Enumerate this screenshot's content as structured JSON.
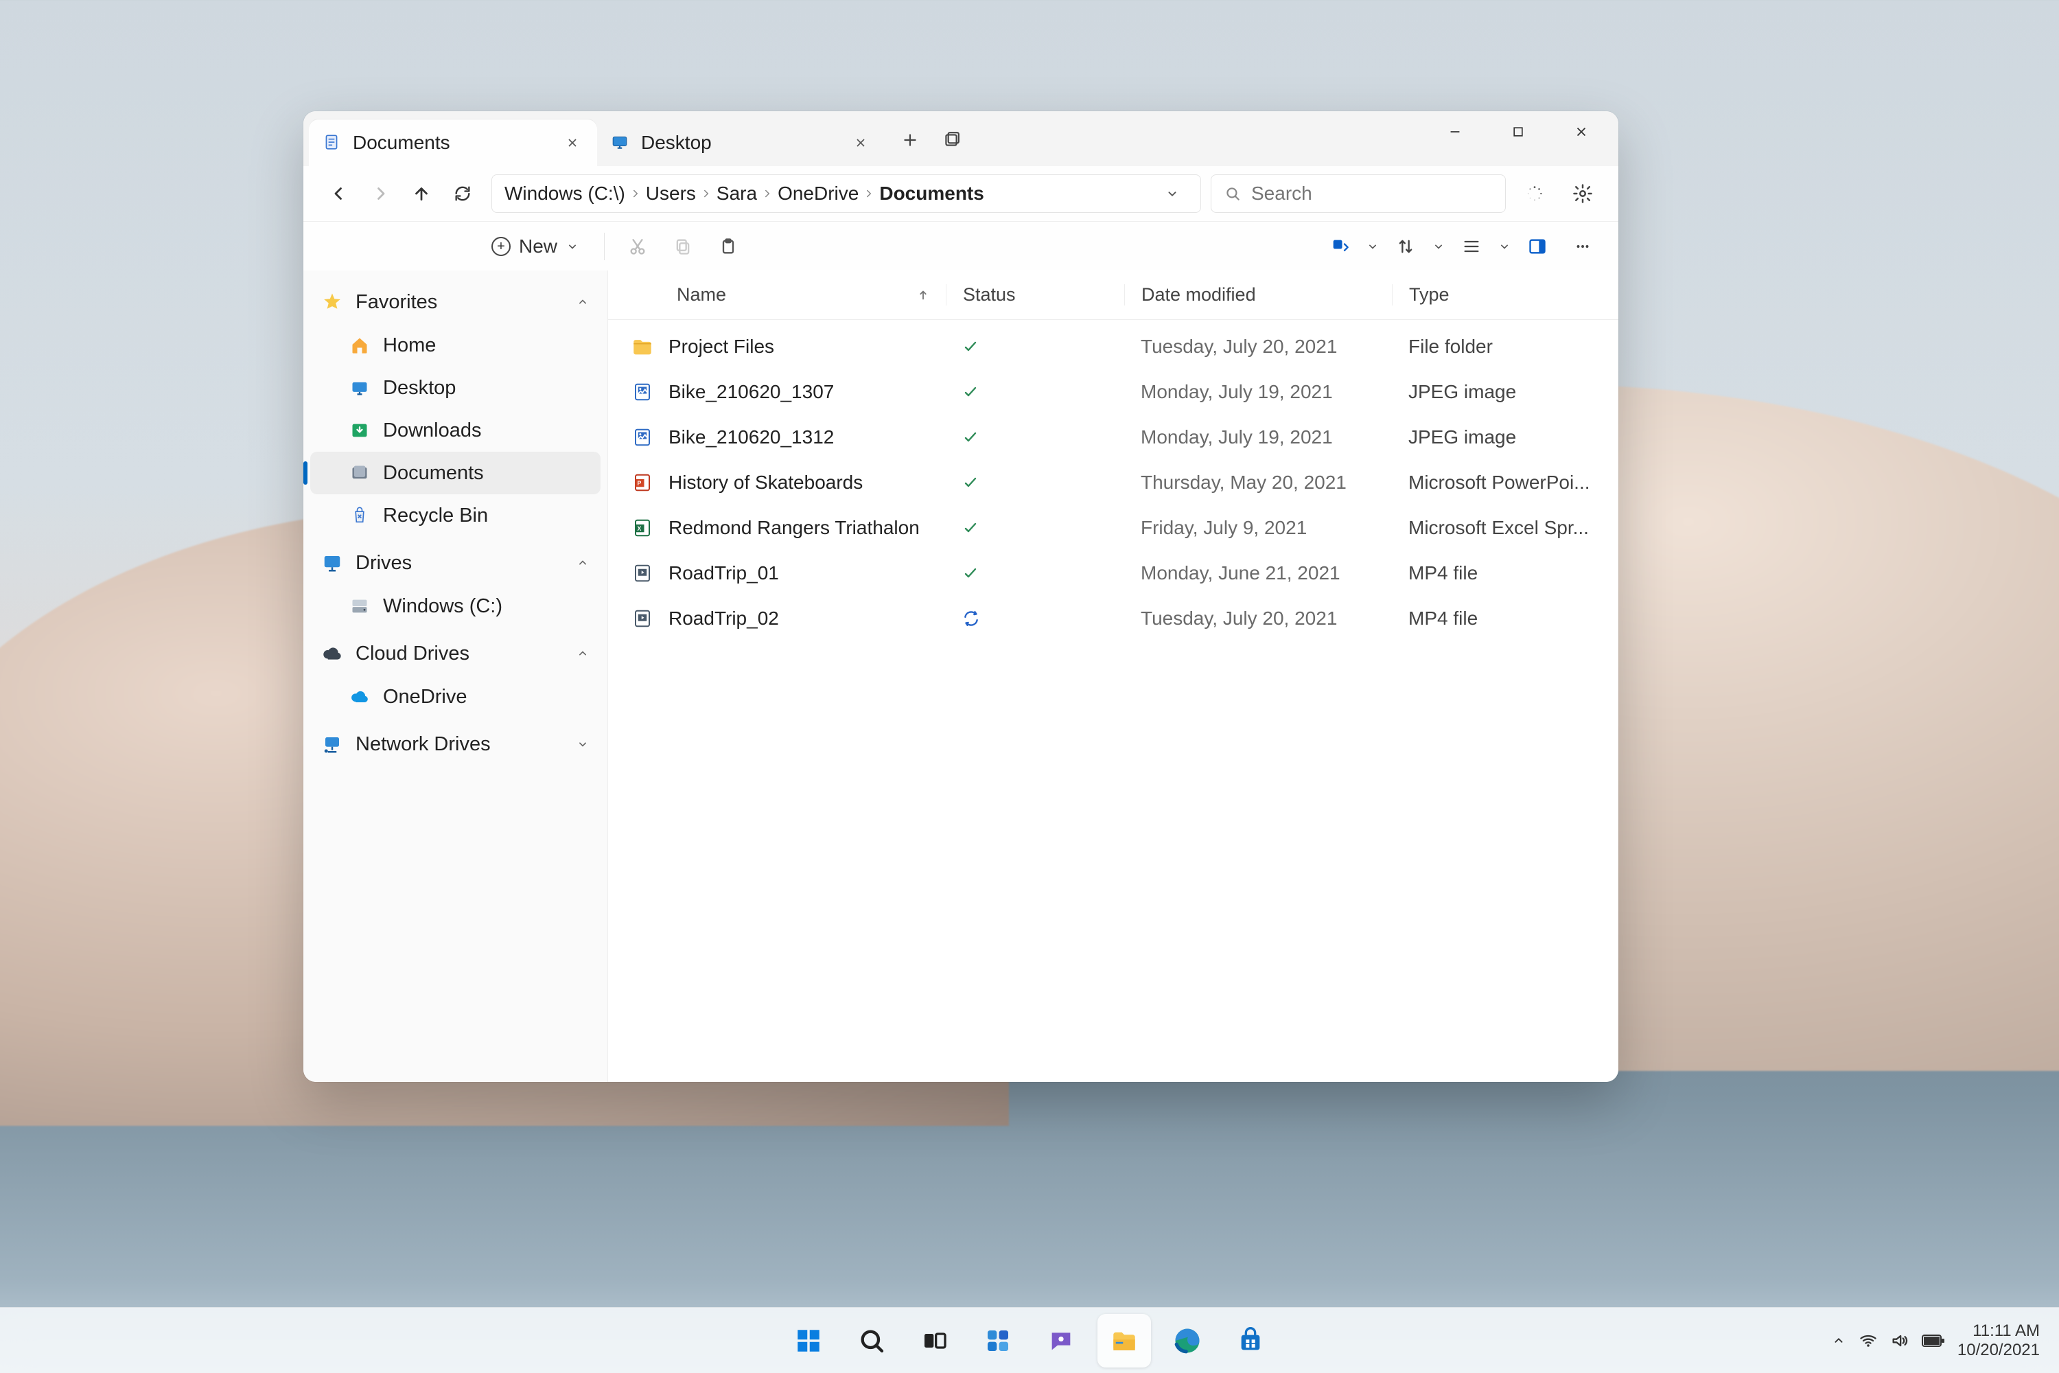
{
  "tabs": [
    {
      "title": "Documents",
      "active": true,
      "icon": "doc"
    },
    {
      "title": "Desktop",
      "active": false,
      "icon": "desktop"
    }
  ],
  "breadcrumbs": [
    "Windows (C:\\)",
    "Users",
    "Sara",
    "OneDrive",
    "Documents"
  ],
  "search": {
    "placeholder": "Search"
  },
  "toolbar": {
    "new_label": "New"
  },
  "sidebar": {
    "sections": [
      {
        "head": "Favorites",
        "icon": "star",
        "expanded": true,
        "items": [
          {
            "label": "Home",
            "icon": "home"
          },
          {
            "label": "Desktop",
            "icon": "desktop"
          },
          {
            "label": "Downloads",
            "icon": "downloads"
          },
          {
            "label": "Documents",
            "icon": "documents",
            "selected": true
          },
          {
            "label": "Recycle Bin",
            "icon": "recycle"
          }
        ]
      },
      {
        "head": "Drives",
        "icon": "monitor",
        "expanded": true,
        "items": [
          {
            "label": "Windows (C:)",
            "icon": "drive"
          }
        ]
      },
      {
        "head": "Cloud Drives",
        "icon": "cloud",
        "expanded": true,
        "items": [
          {
            "label": "OneDrive",
            "icon": "onedrive"
          }
        ]
      },
      {
        "head": "Network Drives",
        "icon": "network",
        "expanded": false,
        "items": []
      }
    ]
  },
  "columns": {
    "name": "Name",
    "status": "Status",
    "date": "Date modified",
    "type": "Type"
  },
  "files": [
    {
      "name": "Project Files",
      "icon": "folder",
      "status": "synced",
      "date": "Tuesday, July 20, 2021",
      "type": "File folder"
    },
    {
      "name": "Bike_210620_1307",
      "icon": "image",
      "status": "synced",
      "date": "Monday, July 19, 2021",
      "type": "JPEG image"
    },
    {
      "name": "Bike_210620_1312",
      "icon": "image",
      "status": "synced",
      "date": "Monday, July 19, 2021",
      "type": "JPEG image"
    },
    {
      "name": "History of Skateboards",
      "icon": "ppt",
      "status": "synced",
      "date": "Thursday, May 20, 2021",
      "type": "Microsoft PowerPoi..."
    },
    {
      "name": "Redmond Rangers Triathalon",
      "icon": "xls",
      "status": "synced",
      "date": "Friday, July 9, 2021",
      "type": "Microsoft Excel Spr..."
    },
    {
      "name": "RoadTrip_01",
      "icon": "video",
      "status": "synced",
      "date": "Monday, June 21, 2021",
      "type": "MP4 file"
    },
    {
      "name": "RoadTrip_02",
      "icon": "video",
      "status": "syncing",
      "date": "Tuesday, July 20, 2021",
      "type": "MP4 file"
    }
  ],
  "taskbar": {
    "apps": [
      "start",
      "search",
      "taskview",
      "widgets",
      "chat",
      "explorer",
      "edge",
      "store"
    ],
    "active_app": "explorer",
    "time": "11:11 AM",
    "date": "10/20/2021"
  }
}
